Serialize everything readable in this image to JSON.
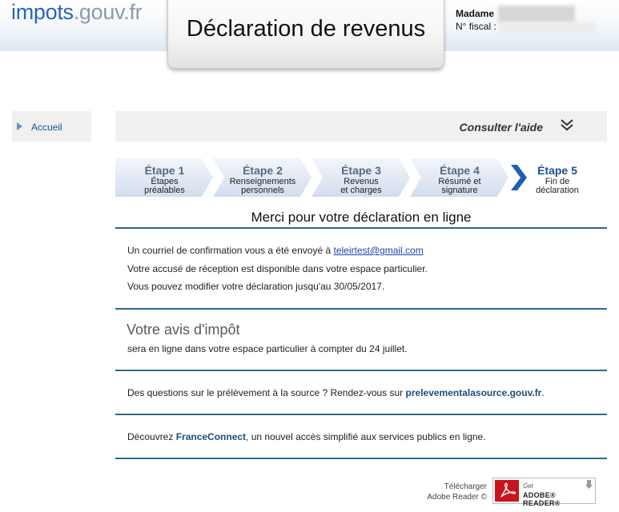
{
  "header": {
    "logo_part1": "impots",
    "logo_part2": ".gouv.fr",
    "title": "Déclaration de revenus",
    "user_label": "Madame",
    "fiscal_label": "N° fiscal :"
  },
  "sidebar": {
    "items": [
      {
        "label": "Accueil"
      }
    ]
  },
  "help": {
    "label": "Consulter l'aide"
  },
  "steps": [
    {
      "title": "Étape 1",
      "subtitle": "Étapes préalables",
      "line1": "Étapes",
      "line2": "préalables",
      "active": false
    },
    {
      "title": "Étape 2",
      "subtitle": "Renseignements personnels",
      "line1": "Renseignements",
      "line2": "personnels",
      "active": false
    },
    {
      "title": "Étape 3",
      "subtitle": "Revenus et charges",
      "line1": "Revenus",
      "line2": "et charges",
      "active": false
    },
    {
      "title": "Étape 4",
      "subtitle": "Résumé et signature",
      "line1": "Résumé et",
      "line2": "signature",
      "active": false
    },
    {
      "title": "Étape 5",
      "subtitle": "Fin de déclaration",
      "line1": "Fin de",
      "line2": "déclaration",
      "active": true
    }
  ],
  "confirmation": {
    "heading": "Merci pour votre déclaration en ligne",
    "email_prefix": "Un courriel de confirmation vous a été envoyé à ",
    "email": "teleirtest@gmail.com",
    "receipt_text": "Votre accusé de réception est disponible dans votre espace particulier.",
    "modify_text": "Vous pouvez modifier votre déclaration jusqu'au 30/05/2017."
  },
  "avis": {
    "title": "Votre avis d'impôt",
    "text": "sera en ligne dans votre espace particulier à compter du 24 juillet."
  },
  "prelevement": {
    "prefix": "Des questions sur le prélèvement à la source ? Rendez-vous sur ",
    "link": "prelevementalasource.gouv.fr",
    "suffix": "."
  },
  "franceconnect": {
    "prefix": "Découvrez ",
    "link": "FranceConnect",
    "suffix": ", un nouvel accès simplifié aux services publics en ligne."
  },
  "download": {
    "line1": "Télécharger",
    "line2": "Adobe Reader ©",
    "badge_get": "Get",
    "badge_name": "ADOBE® READER®"
  },
  "colors": {
    "accent": "#1d4f94",
    "separator": "#2a6a86",
    "step_bg": "#dde6f3"
  }
}
